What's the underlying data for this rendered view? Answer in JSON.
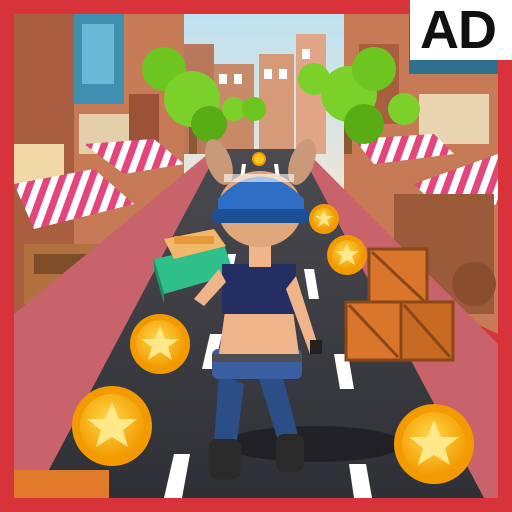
{
  "badge": {
    "label": "AD"
  },
  "colors": {
    "frame": "#d8323a",
    "sky": "#cfe8f2",
    "road": "#3b3b42",
    "sidewalk": "#c9636b",
    "coin_outer": "#f7a80f",
    "coin_inner": "#ffca1c",
    "crate": "#d9762b",
    "tree": "#7bd12a",
    "cap": "#2e6fc5",
    "awning_stripe": "#e3467c"
  },
  "scene": {
    "player": "runner-girl",
    "coins_visible": 6,
    "obstacles": [
      "fruit-cart",
      "wooden-crates"
    ]
  }
}
